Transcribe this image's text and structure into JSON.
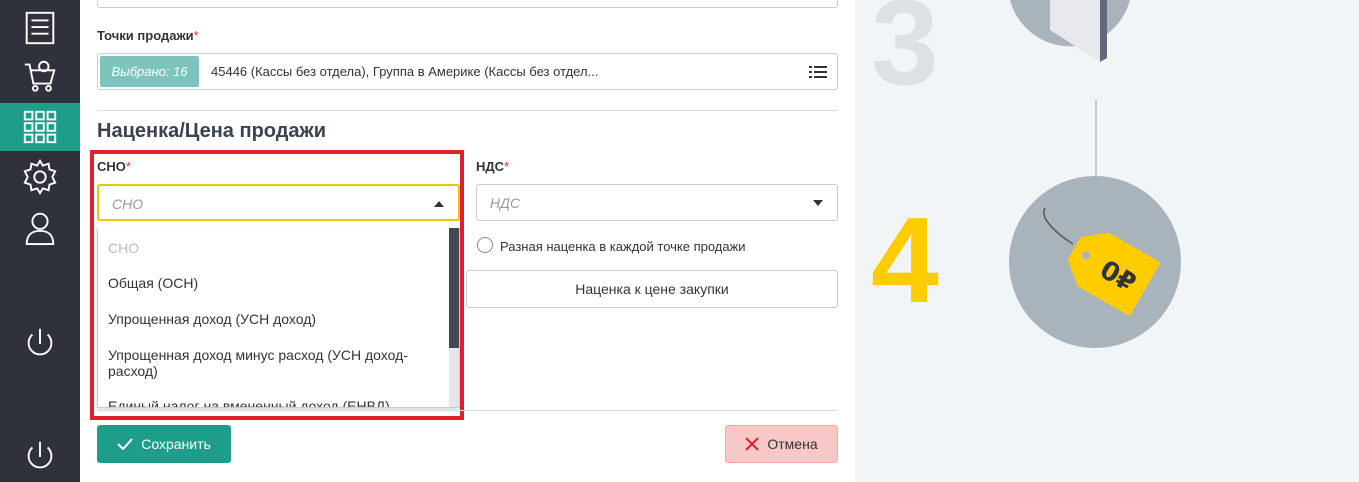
{
  "sidebar": {
    "items": [
      {
        "icon": "document-list-icon"
      },
      {
        "icon": "cart-icon"
      },
      {
        "icon": "grid-icon",
        "active": true
      },
      {
        "icon": "gear-icon"
      },
      {
        "icon": "user-icon"
      },
      {
        "icon": "power-icon"
      },
      {
        "icon": "power-icon"
      }
    ]
  },
  "form": {
    "points_label": "Точки продажи",
    "required_mark": "*",
    "points_badge": "Выбрано: 16",
    "points_value": "45446 (Кассы без отдела), Группа в Америке (Кассы без отдел...",
    "section_title": "Наценка/Цена продажи",
    "sno_label": "СНО",
    "sno_placeholder": "СНО",
    "nds_label": "НДС",
    "nds_placeholder": "НДС",
    "sno_options": [
      "СНО",
      "Общая (ОСН)",
      "Упрощенная доход (УСН доход)",
      "Упрощенная доход минус расход (УСН доход-расход)",
      "Единый налог на вмененный доход (ЕНВД)"
    ],
    "radio_label": "Разная наценка в каждой точке продажи",
    "markup_button": "Наценка к цене закупки",
    "save_button": "Сохранить",
    "cancel_button": "Отмена"
  },
  "illustration": {
    "step_3": "3",
    "step_4": "4",
    "price_tag": "0₽"
  },
  "colors": {
    "sidebar_bg": "#2f323a",
    "accent": "#1e9e8a",
    "highlight": "#e0202c",
    "step_yellow": "#ffcc00",
    "cancel_bg": "#f8c8c8"
  }
}
